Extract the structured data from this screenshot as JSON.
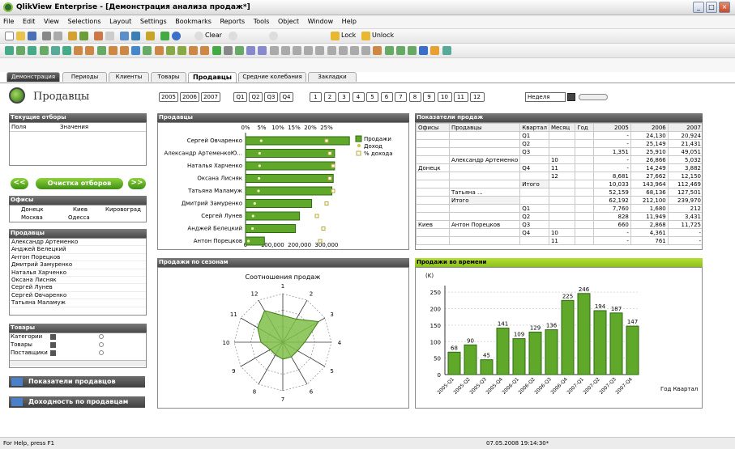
{
  "window": {
    "title": "QlikView Enterprise - [Демонстрация анализа продаж*]"
  },
  "menu": [
    "File",
    "Edit",
    "View",
    "Selections",
    "Layout",
    "Settings",
    "Bookmarks",
    "Reports",
    "Tools",
    "Object",
    "Window",
    "Help"
  ],
  "toolbar": {
    "clear_label": "Clear",
    "lock_label": "Lock",
    "unlock_label": "Unlock"
  },
  "tabs": [
    "Демонстрация",
    "Периоды",
    "Клиенты",
    "Товары",
    "Продавцы",
    "Средние колебания",
    "Закладки"
  ],
  "active_tab": "Продавцы",
  "sheet": {
    "title": "Продавцы"
  },
  "years": [
    "2005",
    "2006",
    "2007"
  ],
  "quarters": [
    "Q1",
    "Q2",
    "Q3",
    "Q4"
  ],
  "months": [
    "1",
    "2",
    "3",
    "4",
    "5",
    "6",
    "7",
    "8",
    "9",
    "10",
    "11",
    "12"
  ],
  "period_select": "Неделя",
  "current_selections": {
    "title": "Текущие отборы",
    "col1": "Поля",
    "col2": "Значения"
  },
  "clear_selections": "Очистка отборов",
  "offices": {
    "title": "Офисы",
    "items": [
      "Донецк",
      "Киев",
      "Кировоград",
      "Москва",
      "Одесса"
    ]
  },
  "salespeople": {
    "title": "Продавцы",
    "items": [
      "Александр Артеменко",
      "Анджей Белецкий",
      "Антон Порецков",
      "Дмитрий Замуренко",
      "Наталья Харченко",
      "Оксана Лисняк",
      "Сергей Лунев",
      "Сергей Овчаренко",
      "Татьяна Маламуж"
    ]
  },
  "goods": {
    "title": "Товары",
    "items": [
      "Категории",
      "Товары",
      "Поставщики"
    ]
  },
  "buttons": {
    "kpi": "Показатели продавцов",
    "profit": "Доходность по продавцам"
  },
  "bar_chart": {
    "title": "Продавцы",
    "legend": [
      "Продажи",
      "Доход",
      "% дохода"
    ]
  },
  "kpi_table": {
    "title": "Показатели продаж",
    "headers": [
      "Офисы",
      "Продавцы",
      "Квартал",
      "Месяц",
      "Год",
      "2005",
      "2006",
      "2007"
    ],
    "rows": [
      [
        "",
        "",
        "Q1",
        "",
        "",
        "-",
        "24,130",
        "20,924"
      ],
      [
        "",
        "",
        "Q2",
        "",
        "",
        "-",
        "25,149",
        "21,431"
      ],
      [
        "",
        "",
        "Q3",
        "",
        "",
        "1,351",
        "25,910",
        "49,051"
      ],
      [
        "",
        "Александр Артеменко",
        "",
        "10",
        "",
        "-",
        "26,866",
        "5,032"
      ],
      [
        "Донецк",
        "",
        "Q4",
        "11",
        "",
        "-",
        "14,249",
        "3,882"
      ],
      [
        "",
        "",
        "",
        "12",
        "",
        "8,681",
        "27,662",
        "12,150"
      ],
      [
        "",
        "",
        "Итого",
        "",
        "",
        "10,033",
        "143,964",
        "112,469"
      ],
      [
        "",
        "Татьяна ...",
        "",
        "",
        "",
        "52,159",
        "68,136",
        "127,501"
      ],
      [
        "",
        "Итого",
        "",
        "",
        "",
        "62,192",
        "212,100",
        "239,970"
      ],
      [
        "",
        "",
        "Q1",
        "",
        "",
        "7,760",
        "1,680",
        "212"
      ],
      [
        "",
        "",
        "Q2",
        "",
        "",
        "828",
        "11,949",
        "3,431"
      ],
      [
        "Киев",
        "Антон Порецков",
        "Q3",
        "",
        "",
        "660",
        "2,868",
        "11,725"
      ],
      [
        "",
        "",
        "Q4",
        "10",
        "",
        "-",
        "4,361",
        "-"
      ],
      [
        "",
        "",
        "",
        "11",
        "",
        "-",
        "761",
        "-"
      ]
    ]
  },
  "radar": {
    "title": "Продажи по сезонам",
    "subtitle": "Соотношения продаж",
    "labels": [
      "1",
      "2",
      "3",
      "4",
      "5",
      "6",
      "7",
      "8",
      "9",
      "10",
      "11",
      "12"
    ]
  },
  "chart_data": [
    {
      "type": "bar",
      "orientation": "horizontal",
      "title": "Продавцы",
      "categories": [
        "Сергей Овчаренко",
        "Александр АртеменкоЮ...",
        "Наталья Харченко",
        "Оксана Лисняк",
        "Татьяна Маламуж",
        "Дмитрий Замуренко",
        "Сергей Лунев",
        "Анджей Белецкий",
        "Антон Порецков"
      ],
      "series": [
        {
          "name": "Продажи",
          "values": [
            385000,
            330000,
            330000,
            325000,
            320000,
            245000,
            200000,
            185000,
            70000
          ]
        },
        {
          "name": "Доход",
          "values": [
            58000,
            52000,
            52000,
            50000,
            48000,
            34000,
            28000,
            26000,
            11000
          ]
        },
        {
          "name": "% дохода",
          "values": [
            25,
            26,
            27,
            26,
            27,
            25,
            22,
            24,
            23
          ]
        }
      ],
      "axis_bottom": [
        "0",
        "100,000",
        "200,000",
        "300,000"
      ],
      "axis_top": [
        "0%",
        "5%",
        "10%",
        "15%",
        "20%",
        "25%"
      ]
    },
    {
      "type": "radar",
      "title": "Соотношения продаж",
      "categories": [
        "1",
        "2",
        "3",
        "4",
        "5",
        "6",
        "7",
        "8",
        "9",
        "10",
        "11",
        "12"
      ],
      "values": [
        0.55,
        0.55,
        0.85,
        0.45,
        0.35,
        0.35,
        0.35,
        0.3,
        0.3,
        0.45,
        0.6,
        0.75
      ]
    },
    {
      "type": "bar",
      "title": "Продажи во времени",
      "ylabel": "(K)",
      "xlabel": "Год Квартал",
      "categories": [
        "2005-Q1",
        "2005-Q2",
        "2005-Q3",
        "2005-Q4",
        "2006-Q1",
        "2006-Q2",
        "2006-Q3",
        "2006-Q4",
        "2007-Q1",
        "2007-Q2",
        "2007-Q3",
        "2007-Q4"
      ],
      "values": [
        68,
        90,
        45,
        141,
        109,
        129,
        136,
        225,
        246,
        194,
        187,
        147
      ],
      "yticks": [
        "0",
        "50",
        "100",
        "150",
        "200",
        "250"
      ],
      "ylim": [
        0,
        270
      ]
    }
  ],
  "status": {
    "help": "For Help, press F1",
    "datetime": "07.05.2008 19:14:30*"
  },
  "colors": {
    "green": "#6fb52a",
    "dark_green": "#3f7f15",
    "caption": "#5a5a5a",
    "accent": "#9bd12a"
  }
}
